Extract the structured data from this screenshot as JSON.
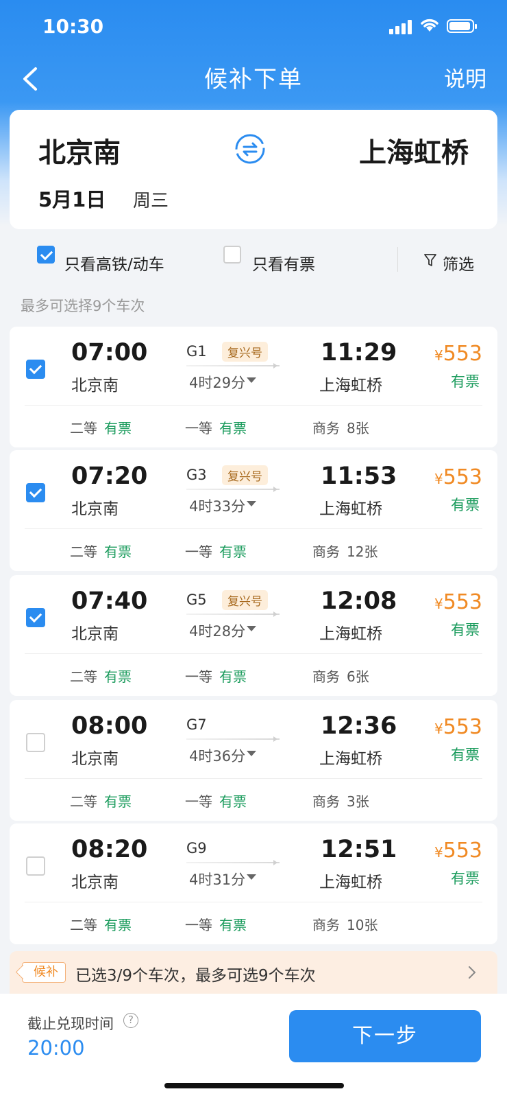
{
  "status_bar": {
    "time": "10:30"
  },
  "nav": {
    "title": "候补下单",
    "help_label": "说明"
  },
  "route": {
    "from": "北京南",
    "to": "上海虹桥",
    "date": "5月1日",
    "weekday": "周三"
  },
  "filters": {
    "high_speed_only": {
      "label": "只看高铁/动车",
      "checked": true
    },
    "available_only": {
      "label": "只看有票",
      "checked": false
    },
    "filter_button": "筛选"
  },
  "hint": "最多可选择9个车次",
  "trains": [
    {
      "selected": true,
      "dep": "07:00",
      "from": "北京南",
      "no": "G1",
      "tag": "复兴号",
      "duration": "4时29分",
      "arr": "11:29",
      "to": "上海虹桥",
      "price_symbol": "¥",
      "price": "553",
      "availability": "有票",
      "seats": [
        {
          "class": "二等",
          "status": "有票"
        },
        {
          "class": "一等",
          "status": "有票"
        },
        {
          "class": "商务",
          "status": "8张"
        }
      ]
    },
    {
      "selected": true,
      "dep": "07:20",
      "from": "北京南",
      "no": "G3",
      "tag": "复兴号",
      "duration": "4时33分",
      "arr": "11:53",
      "to": "上海虹桥",
      "price_symbol": "¥",
      "price": "553",
      "availability": "有票",
      "seats": [
        {
          "class": "二等",
          "status": "有票"
        },
        {
          "class": "一等",
          "status": "有票"
        },
        {
          "class": "商务",
          "status": "12张"
        }
      ]
    },
    {
      "selected": true,
      "dep": "07:40",
      "from": "北京南",
      "no": "G5",
      "tag": "复兴号",
      "duration": "4时28分",
      "arr": "12:08",
      "to": "上海虹桥",
      "price_symbol": "¥",
      "price": "553",
      "availability": "有票",
      "seats": [
        {
          "class": "二等",
          "status": "有票"
        },
        {
          "class": "一等",
          "status": "有票"
        },
        {
          "class": "商务",
          "status": "6张"
        }
      ]
    },
    {
      "selected": false,
      "dep": "08:00",
      "from": "北京南",
      "no": "G7",
      "tag": "",
      "duration": "4时36分",
      "arr": "12:36",
      "to": "上海虹桥",
      "price_symbol": "¥",
      "price": "553",
      "availability": "有票",
      "seats": [
        {
          "class": "二等",
          "status": "有票"
        },
        {
          "class": "一等",
          "status": "有票"
        },
        {
          "class": "商务",
          "status": "3张"
        }
      ]
    },
    {
      "selected": false,
      "dep": "08:20",
      "from": "北京南",
      "no": "G9",
      "tag": "",
      "duration": "4时31分",
      "arr": "12:51",
      "to": "上海虹桥",
      "price_symbol": "¥",
      "price": "553",
      "availability": "有票",
      "seats": [
        {
          "class": "二等",
          "status": "有票"
        },
        {
          "class": "一等",
          "status": "有票"
        },
        {
          "class": "商务",
          "status": "10张"
        }
      ]
    }
  ],
  "waitlist": {
    "tag": "候补",
    "text": "已选3/9个车次，最多可选9个车次"
  },
  "bottom": {
    "deadline_label": "截止兑现时间",
    "info_icon": "?",
    "deadline_time": "20:00",
    "next_button": "下一步"
  },
  "colors": {
    "primary": "#2b8cf0",
    "price": "#f08a24",
    "available": "#1a9b5c",
    "waitlist_bg": "#fdeee2"
  }
}
